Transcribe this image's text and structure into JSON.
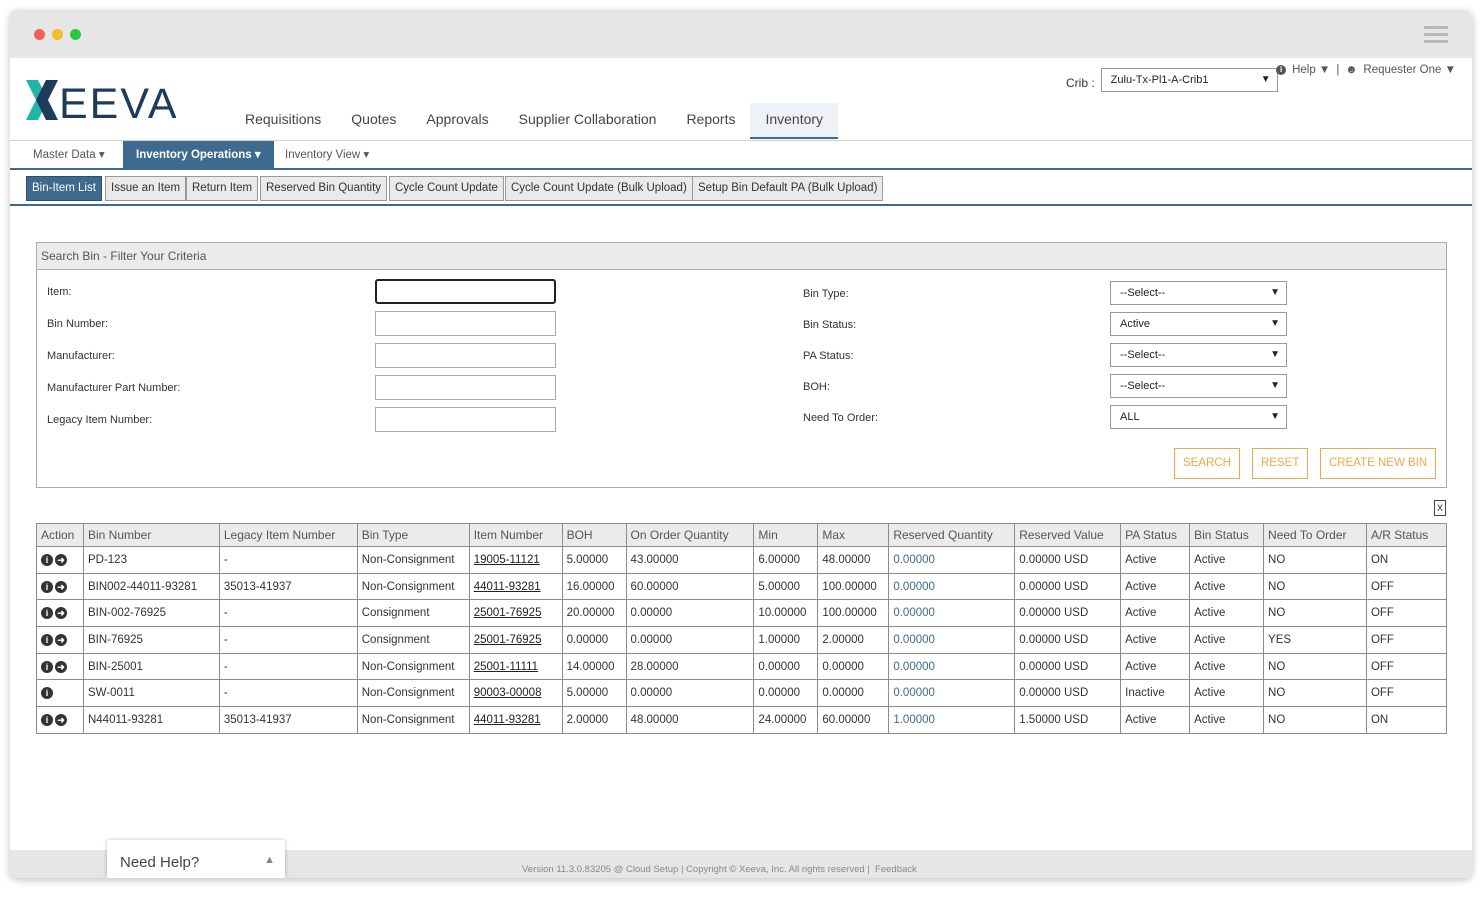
{
  "app": {
    "logo_text": "XEEVA"
  },
  "topnav": {
    "items": [
      "Requisitions",
      "Quotes",
      "Approvals",
      "Supplier Collaboration",
      "Reports",
      "Inventory"
    ]
  },
  "crib": {
    "label": "Crib :",
    "value": "Zulu-Tx-Pl1-A-Crib1"
  },
  "usermenu": {
    "help": "Help",
    "separator": "|",
    "user": "Requester One"
  },
  "subnav": {
    "master_data": "Master Data",
    "inventory_operations": "Inventory Operations",
    "inventory_view": "Inventory View"
  },
  "actionbar": {
    "buttons": [
      "Bin-Item List",
      "Issue an Item",
      "Return Item",
      "Reserved Bin Quantity",
      "Cycle Count Update",
      "Cycle Count Update (Bulk Upload)",
      "Setup Bin Default PA (Bulk Upload)"
    ]
  },
  "search": {
    "title": "Search Bin - Filter Your Criteria",
    "left_labels": [
      "Item:",
      "Bin Number:",
      "Manufacturer:",
      "Manufacturer Part Number:",
      "Legacy Item Number:"
    ],
    "right_labels": [
      "Bin Type:",
      "Bin Status:",
      "PA Status:",
      "BOH:",
      "Need To Order:"
    ],
    "right_values": [
      "--Select--",
      "Active",
      "--Select--",
      "--Select--",
      "ALL"
    ],
    "search_button": "SEARCH",
    "reset_button": "RESET",
    "create_button": "CREATE NEW BIN"
  },
  "export": {
    "icon_label": "X"
  },
  "table": {
    "headers": [
      "Action",
      "Bin Number",
      "Legacy Item Number",
      "Bin Type",
      "Item Number",
      "BOH",
      "On Order Quantity",
      "Min",
      "Max",
      "Reserved Quantity",
      "Reserved Value",
      "PA Status",
      "Bin Status",
      "Need To Order",
      "A/R Status"
    ],
    "rows": [
      {
        "arrow": true,
        "bin": "PD-123",
        "legacy": "-",
        "type": "Non-Consignment",
        "item": "19005-11121",
        "boh": "5.00000",
        "onorder": "43.00000",
        "min": "6.00000",
        "max": "48.00000",
        "resqty": "0.00000",
        "resval": "0.00000 USD",
        "pa": "Active",
        "binstatus": "Active",
        "nto": "NO",
        "ar": "ON"
      },
      {
        "arrow": true,
        "bin": "BIN002-44011-93281",
        "legacy": "35013-41937",
        "type": "Non-Consignment",
        "item": "44011-93281",
        "boh": "16.00000",
        "onorder": "60.00000",
        "min": "5.00000",
        "max": "100.00000",
        "resqty": "0.00000",
        "resval": "0.00000 USD",
        "pa": "Active",
        "binstatus": "Active",
        "nto": "NO",
        "ar": "OFF"
      },
      {
        "arrow": true,
        "bin": "BIN-002-76925",
        "legacy": "-",
        "type": "Consignment",
        "item": "25001-76925",
        "boh": "20.00000",
        "onorder": "0.00000",
        "min": "10.00000",
        "max": "100.00000",
        "resqty": "0.00000",
        "resval": "0.00000 USD",
        "pa": "Active",
        "binstatus": "Active",
        "nto": "NO",
        "ar": "OFF"
      },
      {
        "arrow": true,
        "bin": "BIN-76925",
        "legacy": "-",
        "type": "Consignment",
        "item": "25001-76925",
        "boh": "0.00000",
        "onorder": "0.00000",
        "min": "1.00000",
        "max": "2.00000",
        "resqty": "0.00000",
        "resval": "0.00000 USD",
        "pa": "Active",
        "binstatus": "Active",
        "nto": "YES",
        "ar": "OFF"
      },
      {
        "arrow": true,
        "bin": "BIN-25001",
        "legacy": "-",
        "type": "Non-Consignment",
        "item": "25001-11111",
        "boh": "14.00000",
        "onorder": "28.00000",
        "min": "0.00000",
        "max": "0.00000",
        "resqty": "0.00000",
        "resval": "0.00000 USD",
        "pa": "Active",
        "binstatus": "Active",
        "nto": "NO",
        "ar": "OFF"
      },
      {
        "arrow": false,
        "bin": "SW-0011",
        "legacy": "-",
        "type": "Non-Consignment",
        "item": "90003-00008",
        "boh": "5.00000",
        "onorder": "0.00000",
        "min": "0.00000",
        "max": "0.00000",
        "resqty": "0.00000",
        "resval": "0.00000 USD",
        "pa": "Inactive",
        "binstatus": "Active",
        "nto": "NO",
        "ar": "OFF"
      },
      {
        "arrow": true,
        "bin": "N44011-93281",
        "legacy": "35013-41937",
        "type": "Non-Consignment",
        "item": "44011-93281",
        "boh": "2.00000",
        "onorder": "48.00000",
        "min": "24.00000",
        "max": "60.00000",
        "resqty": "1.00000",
        "resval": "1.50000 USD",
        "pa": "Active",
        "binstatus": "Active",
        "nto": "NO",
        "ar": "ON"
      }
    ]
  },
  "footer": {
    "text": "Version 11.3.0.83205 @ Cloud Setup | Copyright © Xeeva, Inc. All rights reserved |",
    "feedback": "Feedback"
  },
  "needhelp": {
    "label": "Need Help?"
  },
  "colors": {
    "accent": "#3d6a8e",
    "orange": "#f0a64f",
    "logo_teal": "#1fb6a8",
    "logo_navy": "#1f3b5c"
  }
}
